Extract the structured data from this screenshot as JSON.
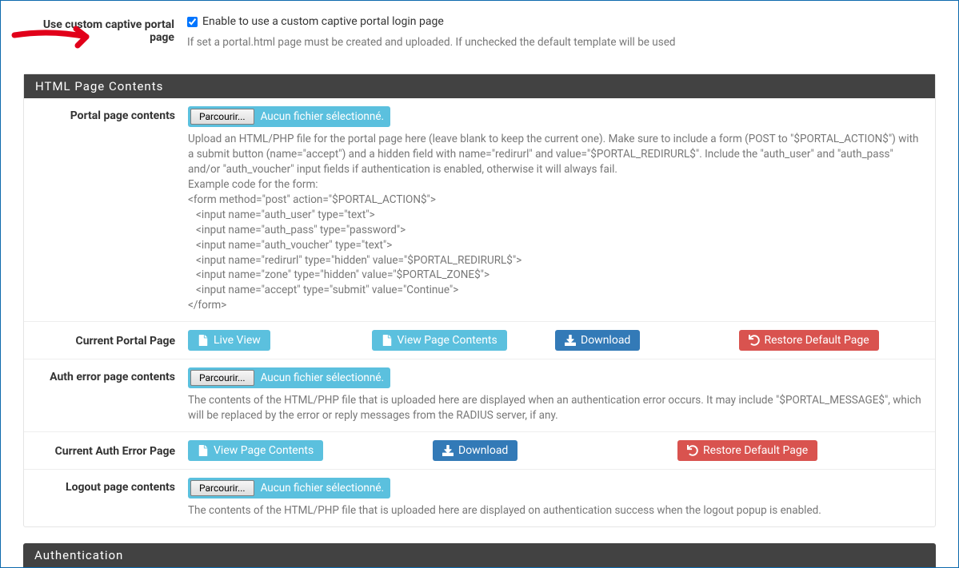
{
  "custom_portal": {
    "label": "Use custom captive portal page",
    "checkbox_text": "Enable to use a custom captive portal login page",
    "help": "If set a portal.html page must be created and uploaded. If unchecked the default template will be used"
  },
  "sections": {
    "html_contents_title": "HTML Page Contents",
    "auth_title": "Authentication"
  },
  "portal_page": {
    "label": "Portal page contents",
    "browse": "Parcourir...",
    "no_file": "Aucun fichier sélectionné.",
    "help1": "Upload an HTML/PHP file for the portal page here (leave blank to keep the current one). Make sure to include a form (POST to \"$PORTAL_ACTION$\") with a submit button (name=\"accept\") and a hidden field with name=\"redirurl\" and value=\"$PORTAL_REDIRURL$\". Include the \"auth_user\" and \"auth_pass\" and/or \"auth_voucher\" input fields if authentication is enabled, otherwise it will always fail.",
    "example_intro": "Example code for the form:",
    "code": "<form method=\"post\" action=\"$PORTAL_ACTION$\">\n   <input name=\"auth_user\" type=\"text\">\n   <input name=\"auth_pass\" type=\"password\">\n   <input name=\"auth_voucher\" type=\"text\">\n   <input name=\"redirurl\" type=\"hidden\" value=\"$PORTAL_REDIRURL$\">\n   <input name=\"zone\" type=\"hidden\" value=\"$PORTAL_ZONE$\">\n   <input name=\"accept\" type=\"submit\" value=\"Continue\">\n</form>"
  },
  "current_portal": {
    "label": "Current Portal Page",
    "live_view": "Live View",
    "view_contents": "View Page Contents",
    "download": "Download",
    "restore": "Restore Default Page"
  },
  "auth_error": {
    "label": "Auth error page contents",
    "browse": "Parcourir...",
    "no_file": "Aucun fichier sélectionné.",
    "help": "The contents of the HTML/PHP file that is uploaded here are displayed when an authentication error occurs. It may include \"$PORTAL_MESSAGE$\", which will be replaced by the error or reply messages from the RADIUS server, if any."
  },
  "current_auth_error": {
    "label": "Current Auth Error Page",
    "view_contents": "View Page Contents",
    "download": "Download",
    "restore": "Restore Default Page"
  },
  "logout": {
    "label": "Logout page contents",
    "browse": "Parcourir...",
    "no_file": "Aucun fichier sélectionné.",
    "help": "The contents of the HTML/PHP file that is uploaded here are displayed on authentication success when the logout popup is enabled."
  }
}
